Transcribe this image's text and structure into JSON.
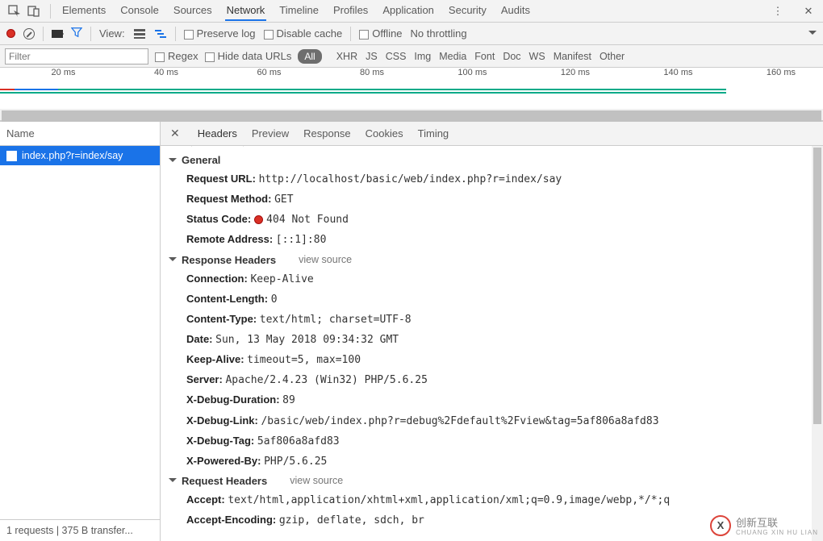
{
  "topTabs": [
    "Elements",
    "Console",
    "Sources",
    "Network",
    "Timeline",
    "Profiles",
    "Application",
    "Security",
    "Audits"
  ],
  "topActive": "Network",
  "toolbar": {
    "viewLabel": "View:",
    "preserveLog": "Preserve log",
    "disableCache": "Disable cache",
    "offline": "Offline",
    "throttling": "No throttling"
  },
  "filter": {
    "placeholder": "Filter",
    "regex": "Regex",
    "hideData": "Hide data URLs",
    "all": "All",
    "types": [
      "XHR",
      "JS",
      "CSS",
      "Img",
      "Media",
      "Font",
      "Doc",
      "WS",
      "Manifest",
      "Other"
    ]
  },
  "timelineTicks": [
    "20 ms",
    "40 ms",
    "60 ms",
    "80 ms",
    "100 ms",
    "120 ms",
    "140 ms",
    "160 ms"
  ],
  "sidebar": {
    "header": "Name",
    "request": "index.php?r=index/say",
    "footer": "1 requests  |  375 B transfer..."
  },
  "detailTabs": [
    "Headers",
    "Preview",
    "Response",
    "Cookies",
    "Timing"
  ],
  "detailActive": "Headers",
  "general": {
    "title": "General",
    "url_k": "Request URL:",
    "url_v": "http://localhost/basic/web/index.php?r=index/say",
    "method_k": "Request Method:",
    "method_v": "GET",
    "status_k": "Status Code:",
    "status_v": "404 Not Found",
    "remote_k": "Remote Address:",
    "remote_v": "[::1]:80"
  },
  "respHdr": {
    "title": "Response Headers",
    "viewSource": "view source",
    "items": [
      {
        "k": "Connection:",
        "v": "Keep-Alive"
      },
      {
        "k": "Content-Length:",
        "v": "0"
      },
      {
        "k": "Content-Type:",
        "v": "text/html; charset=UTF-8"
      },
      {
        "k": "Date:",
        "v": "Sun, 13 May 2018 09:34:32 GMT"
      },
      {
        "k": "Keep-Alive:",
        "v": "timeout=5, max=100"
      },
      {
        "k": "Server:",
        "v": "Apache/2.4.23 (Win32) PHP/5.6.25"
      },
      {
        "k": "X-Debug-Duration:",
        "v": "89"
      },
      {
        "k": "X-Debug-Link:",
        "v": "/basic/web/index.php?r=debug%2Fdefault%2Fview&tag=5af806a8afd83"
      },
      {
        "k": "X-Debug-Tag:",
        "v": "5af806a8afd83"
      },
      {
        "k": "X-Powered-By:",
        "v": "PHP/5.6.25"
      }
    ]
  },
  "reqHdr": {
    "title": "Request Headers",
    "viewSource": "view source",
    "items": [
      {
        "k": "Accept:",
        "v": "text/html,application/xhtml+xml,application/xml;q=0.9,image/webp,*/*;q"
      },
      {
        "k": "Accept-Encoding:",
        "v": "gzip, deflate, sdch, br"
      }
    ]
  },
  "watermark": {
    "main": "创新互联",
    "sub": "CHUANG XIN HU LIAN",
    "badge": "X"
  }
}
